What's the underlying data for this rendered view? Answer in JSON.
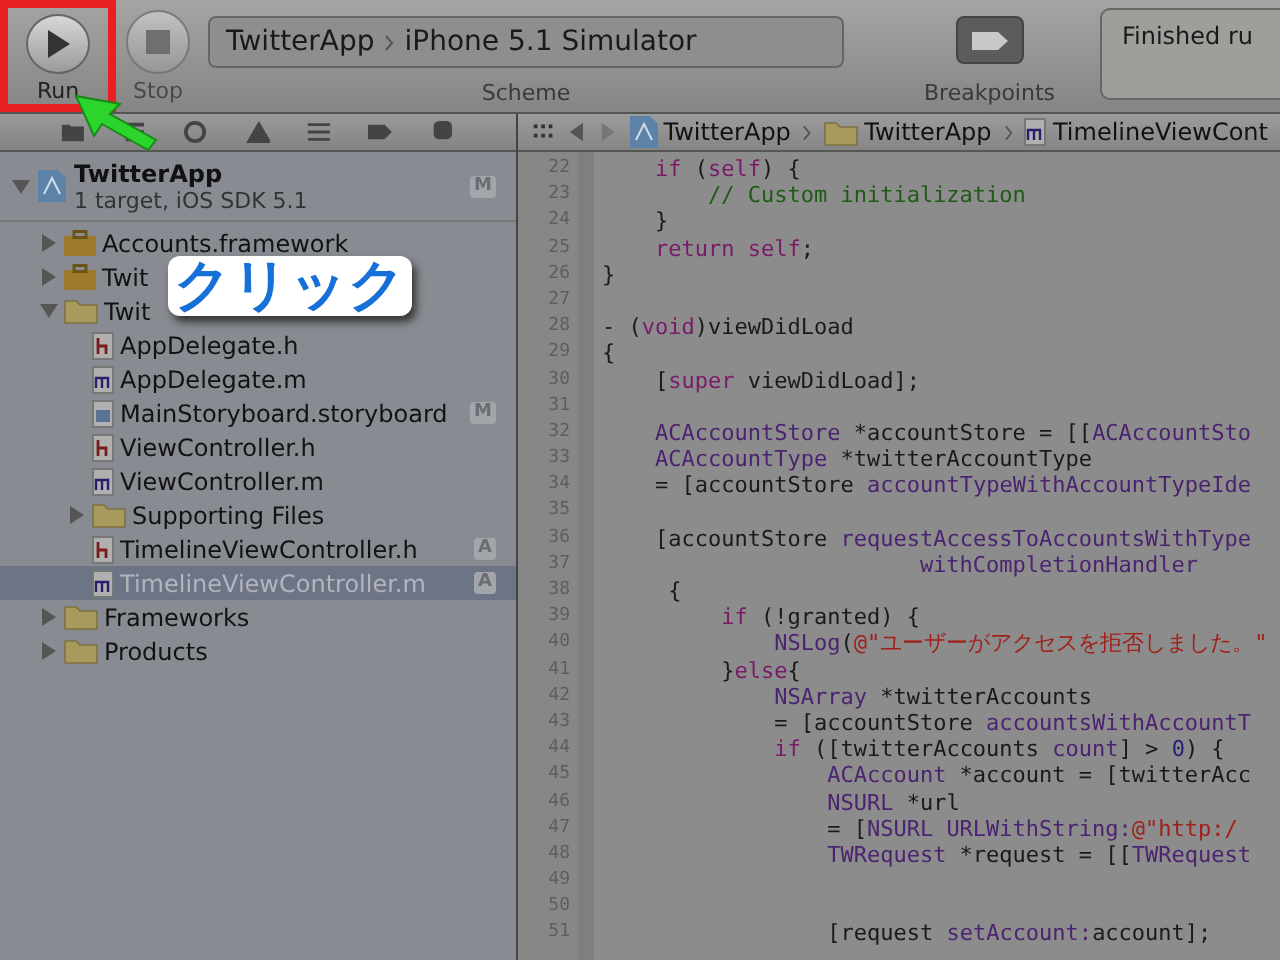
{
  "toolbar": {
    "run_button": {
      "label": "Run",
      "highlighted": true
    },
    "stop_button": {
      "label": "Stop",
      "disabled": true
    },
    "scheme": {
      "target": "TwitterApp",
      "destination": "iPhone 5.1 Simulator",
      "label": "Scheme"
    },
    "breakpoints": {
      "label": "Breakpoints"
    },
    "status": {
      "text": "Finished ru"
    }
  },
  "annotation": {
    "text": "クリック"
  },
  "navigator": {
    "project": {
      "name": "TwitterApp",
      "subtitle": "1 target, iOS SDK 5.1",
      "badge": "M"
    },
    "tree": [
      {
        "name": "Accounts.framework",
        "kind": "framework",
        "expanded": false,
        "selected": false
      },
      {
        "name": "Twit",
        "kind": "framework",
        "expanded": false,
        "selected": false
      },
      {
        "name": "Twit",
        "kind": "folder",
        "expanded": true,
        "selected": false,
        "children": [
          {
            "name": "AppDelegate.h",
            "kind": "header",
            "selected": false
          },
          {
            "name": "AppDelegate.m",
            "kind": "impl",
            "selected": false
          },
          {
            "name": "MainStoryboard.storyboard",
            "kind": "storyboard",
            "badge": "M",
            "selected": false
          },
          {
            "name": "ViewController.h",
            "kind": "header",
            "selected": false
          },
          {
            "name": "ViewController.m",
            "kind": "impl",
            "selected": false
          },
          {
            "name": "Supporting Files",
            "kind": "folder",
            "expanded": false,
            "selected": false
          },
          {
            "name": "TimelineViewController.h",
            "kind": "header",
            "badge": "A",
            "selected": false
          },
          {
            "name": "TimelineViewController.m",
            "kind": "impl",
            "badge": "A",
            "selected": true
          }
        ]
      },
      {
        "name": "Frameworks",
        "kind": "folder",
        "expanded": false,
        "selected": false
      },
      {
        "name": "Products",
        "kind": "folder",
        "expanded": false,
        "selected": false
      }
    ]
  },
  "editor": {
    "breadcrumbs": [
      {
        "kind": "project",
        "text": "TwitterApp"
      },
      {
        "kind": "folder",
        "text": "TwitterApp"
      },
      {
        "kind": "impl",
        "text": "TimelineViewCont"
      }
    ],
    "lines": [
      {
        "number": "22",
        "code": [
          {
            "t": "    if",
            "kind": "keyword"
          },
          {
            "t": " ("
          },
          {
            "t": "self",
            "kind": "keyword"
          },
          {
            "t": ") {"
          }
        ]
      },
      {
        "number": "23",
        "code": [
          {
            "t": "        // Custom initialization",
            "kind": "comment"
          }
        ]
      },
      {
        "number": "24",
        "code": [
          {
            "t": "    }"
          }
        ]
      },
      {
        "number": "25",
        "code": [
          {
            "t": "    return",
            "kind": "keyword"
          },
          {
            "t": " self",
            "kind": "keyword"
          },
          {
            "t": ";"
          }
        ]
      },
      {
        "number": "26",
        "code": [
          {
            "t": "}"
          }
        ]
      },
      {
        "number": "27"
      },
      {
        "number": "28",
        "code": [
          {
            "t": "- ("
          },
          {
            "t": "void",
            "kind": "keyword"
          },
          {
            "t": ")viewDidLoad"
          }
        ]
      },
      {
        "number": "29",
        "code": [
          {
            "t": "{"
          }
        ]
      },
      {
        "number": "30",
        "code": [
          {
            "t": "    ["
          },
          {
            "t": "super",
            "kind": "keyword"
          },
          {
            "t": " viewDidLoad];"
          }
        ]
      },
      {
        "number": "31"
      },
      {
        "number": "32",
        "code": [
          {
            "t": "    ACAccountStore",
            "kind": "type"
          },
          {
            "t": " *accountStore = [["
          },
          {
            "t": "ACAccountSto",
            "kind": "type"
          }
        ]
      },
      {
        "number": "33",
        "code": [
          {
            "t": "    ACAccountType",
            "kind": "type"
          },
          {
            "t": " *twitterAccountType"
          }
        ]
      },
      {
        "number": "34",
        "code": [
          {
            "t": "    = [accountStore"
          },
          {
            "t": " accountTypeWithAccountTypeIde",
            "kind": "type"
          }
        ]
      },
      {
        "number": "35"
      },
      {
        "number": "36",
        "code": [
          {
            "t": "    [accountStore"
          },
          {
            "t": " requestAccessToAccountsWithType",
            "kind": "type"
          }
        ]
      },
      {
        "number": "37",
        "code": [
          {
            "t": "                        withCompletionHandler",
            "kind": "type"
          }
        ]
      },
      {
        "number": "38",
        "code": [
          {
            "t": "     {"
          }
        ]
      },
      {
        "number": "39",
        "code": [
          {
            "t": "         if",
            "kind": "keyword"
          },
          {
            "t": " (!granted) {"
          }
        ]
      },
      {
        "number": "40",
        "code": [
          {
            "t": "             NSLog",
            "kind": "type"
          },
          {
            "t": "("
          },
          {
            "t": "@\"ユーザーがアクセスを拒否しました。\"",
            "kind": "string"
          }
        ]
      },
      {
        "number": "41",
        "code": [
          {
            "t": "         }"
          },
          {
            "t": "else",
            "kind": "keyword"
          },
          {
            "t": "{"
          }
        ]
      },
      {
        "number": "42",
        "code": [
          {
            "t": "             NSArray",
            "kind": "type"
          },
          {
            "t": " *twitterAccounts"
          }
        ]
      },
      {
        "number": "43",
        "code": [
          {
            "t": "             = [accountStore"
          },
          {
            "t": " accountsWithAccountT",
            "kind": "type"
          }
        ]
      },
      {
        "number": "44",
        "code": [
          {
            "t": "             if",
            "kind": "keyword"
          },
          {
            "t": " ([twitterAccounts"
          },
          {
            "t": " count",
            "kind": "type"
          },
          {
            "t": "] > "
          },
          {
            "t": "0",
            "kind": "number"
          },
          {
            "t": ") {"
          }
        ]
      },
      {
        "number": "45",
        "code": [
          {
            "t": "                 ACAccount",
            "kind": "type"
          },
          {
            "t": " *account = [twitterAcc"
          }
        ]
      },
      {
        "number": "46",
        "code": [
          {
            "t": "                 NSURL",
            "kind": "type"
          },
          {
            "t": " *url"
          }
        ]
      },
      {
        "number": "47",
        "code": [
          {
            "t": "                 = ["
          },
          {
            "t": "NSURL URLWithString:",
            "kind": "type"
          },
          {
            "t": "@\"http:/",
            "kind": "string"
          }
        ]
      },
      {
        "number": "48",
        "code": [
          {
            "t": "                 TWRequest",
            "kind": "type"
          },
          {
            "t": " *request = [["
          },
          {
            "t": "TWRequest",
            "kind": "type"
          }
        ]
      },
      {
        "number": "49"
      },
      {
        "number": "50"
      },
      {
        "number": "51",
        "code": [
          {
            "t": "                 [request"
          },
          {
            "t": " setAccount:",
            "kind": "type"
          },
          {
            "t": "account];"
          }
        ]
      }
    ]
  }
}
